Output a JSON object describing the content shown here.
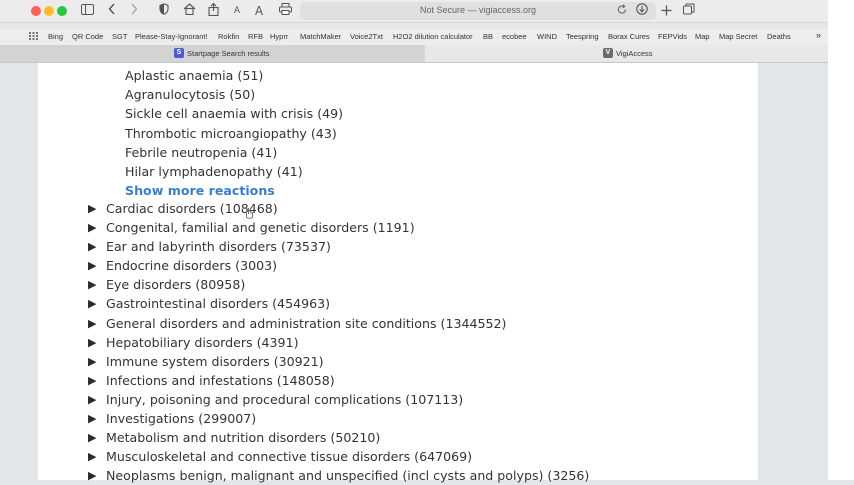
{
  "browser": {
    "address_text": "Not Secure — vigiaccess.org",
    "icons": {
      "sidebar": "sidebar-icon",
      "back": "chevron-left-icon",
      "forward": "chevron-right-icon",
      "shield": "shield-icon",
      "home": "home-icon",
      "share": "share-icon",
      "text_small": "A",
      "text_large": "A",
      "print": "printer-icon",
      "reload": "reload-icon",
      "download": "download-icon",
      "new_tab": "plus-icon",
      "tabs": "tabs-icon"
    },
    "bookmarks": [
      "Bing",
      "QR Code",
      "SGT",
      "Please-Stay-Ignorant!",
      "Rokfin",
      "RFB",
      "Hyprr",
      "MatchMaker",
      "Voice2Txt",
      "H2O2 dilution calculator",
      "BB",
      "ecobee",
      "WIND",
      "Teespring",
      "Borax Cures",
      "FEPVids",
      "Map",
      "Map Secret",
      "Deaths"
    ],
    "bookmarks_more": "»",
    "tabs": [
      {
        "label": "Startpage Search results",
        "favicon": "S"
      },
      {
        "label": "VigiAccess",
        "favicon": "V"
      }
    ]
  },
  "content": {
    "reactions": [
      "Aplastic anaemia (51)",
      "Agranulocytosis (50)",
      "Sickle cell anaemia with crisis (49)",
      "Thrombotic microangiopathy (43)",
      "Febrile neutropenia (41)",
      "Hilar lymphadenopathy (41)"
    ],
    "show_more": "Show more reactions",
    "triangle": "▶",
    "categories": [
      "Cardiac disorders (108468)",
      "Congenital, familial and genetic disorders (1191)",
      "Ear and labyrinth disorders (73537)",
      "Endocrine disorders (3003)",
      "Eye disorders (80958)",
      "Gastrointestinal disorders (454963)",
      "General disorders and administration site conditions (1344552)",
      "Hepatobiliary disorders (4391)",
      "Immune system disorders (30921)",
      "Infections and infestations (148058)",
      "Injury, poisoning and procedural complications (107113)",
      "Investigations (299007)",
      "Metabolism and nutrition disorders (50210)",
      "Musculoskeletal and connective tissue disorders (647069)",
      "Neoplasms benign, malignant and unspecified (incl cysts and polyps) (3256)"
    ]
  }
}
